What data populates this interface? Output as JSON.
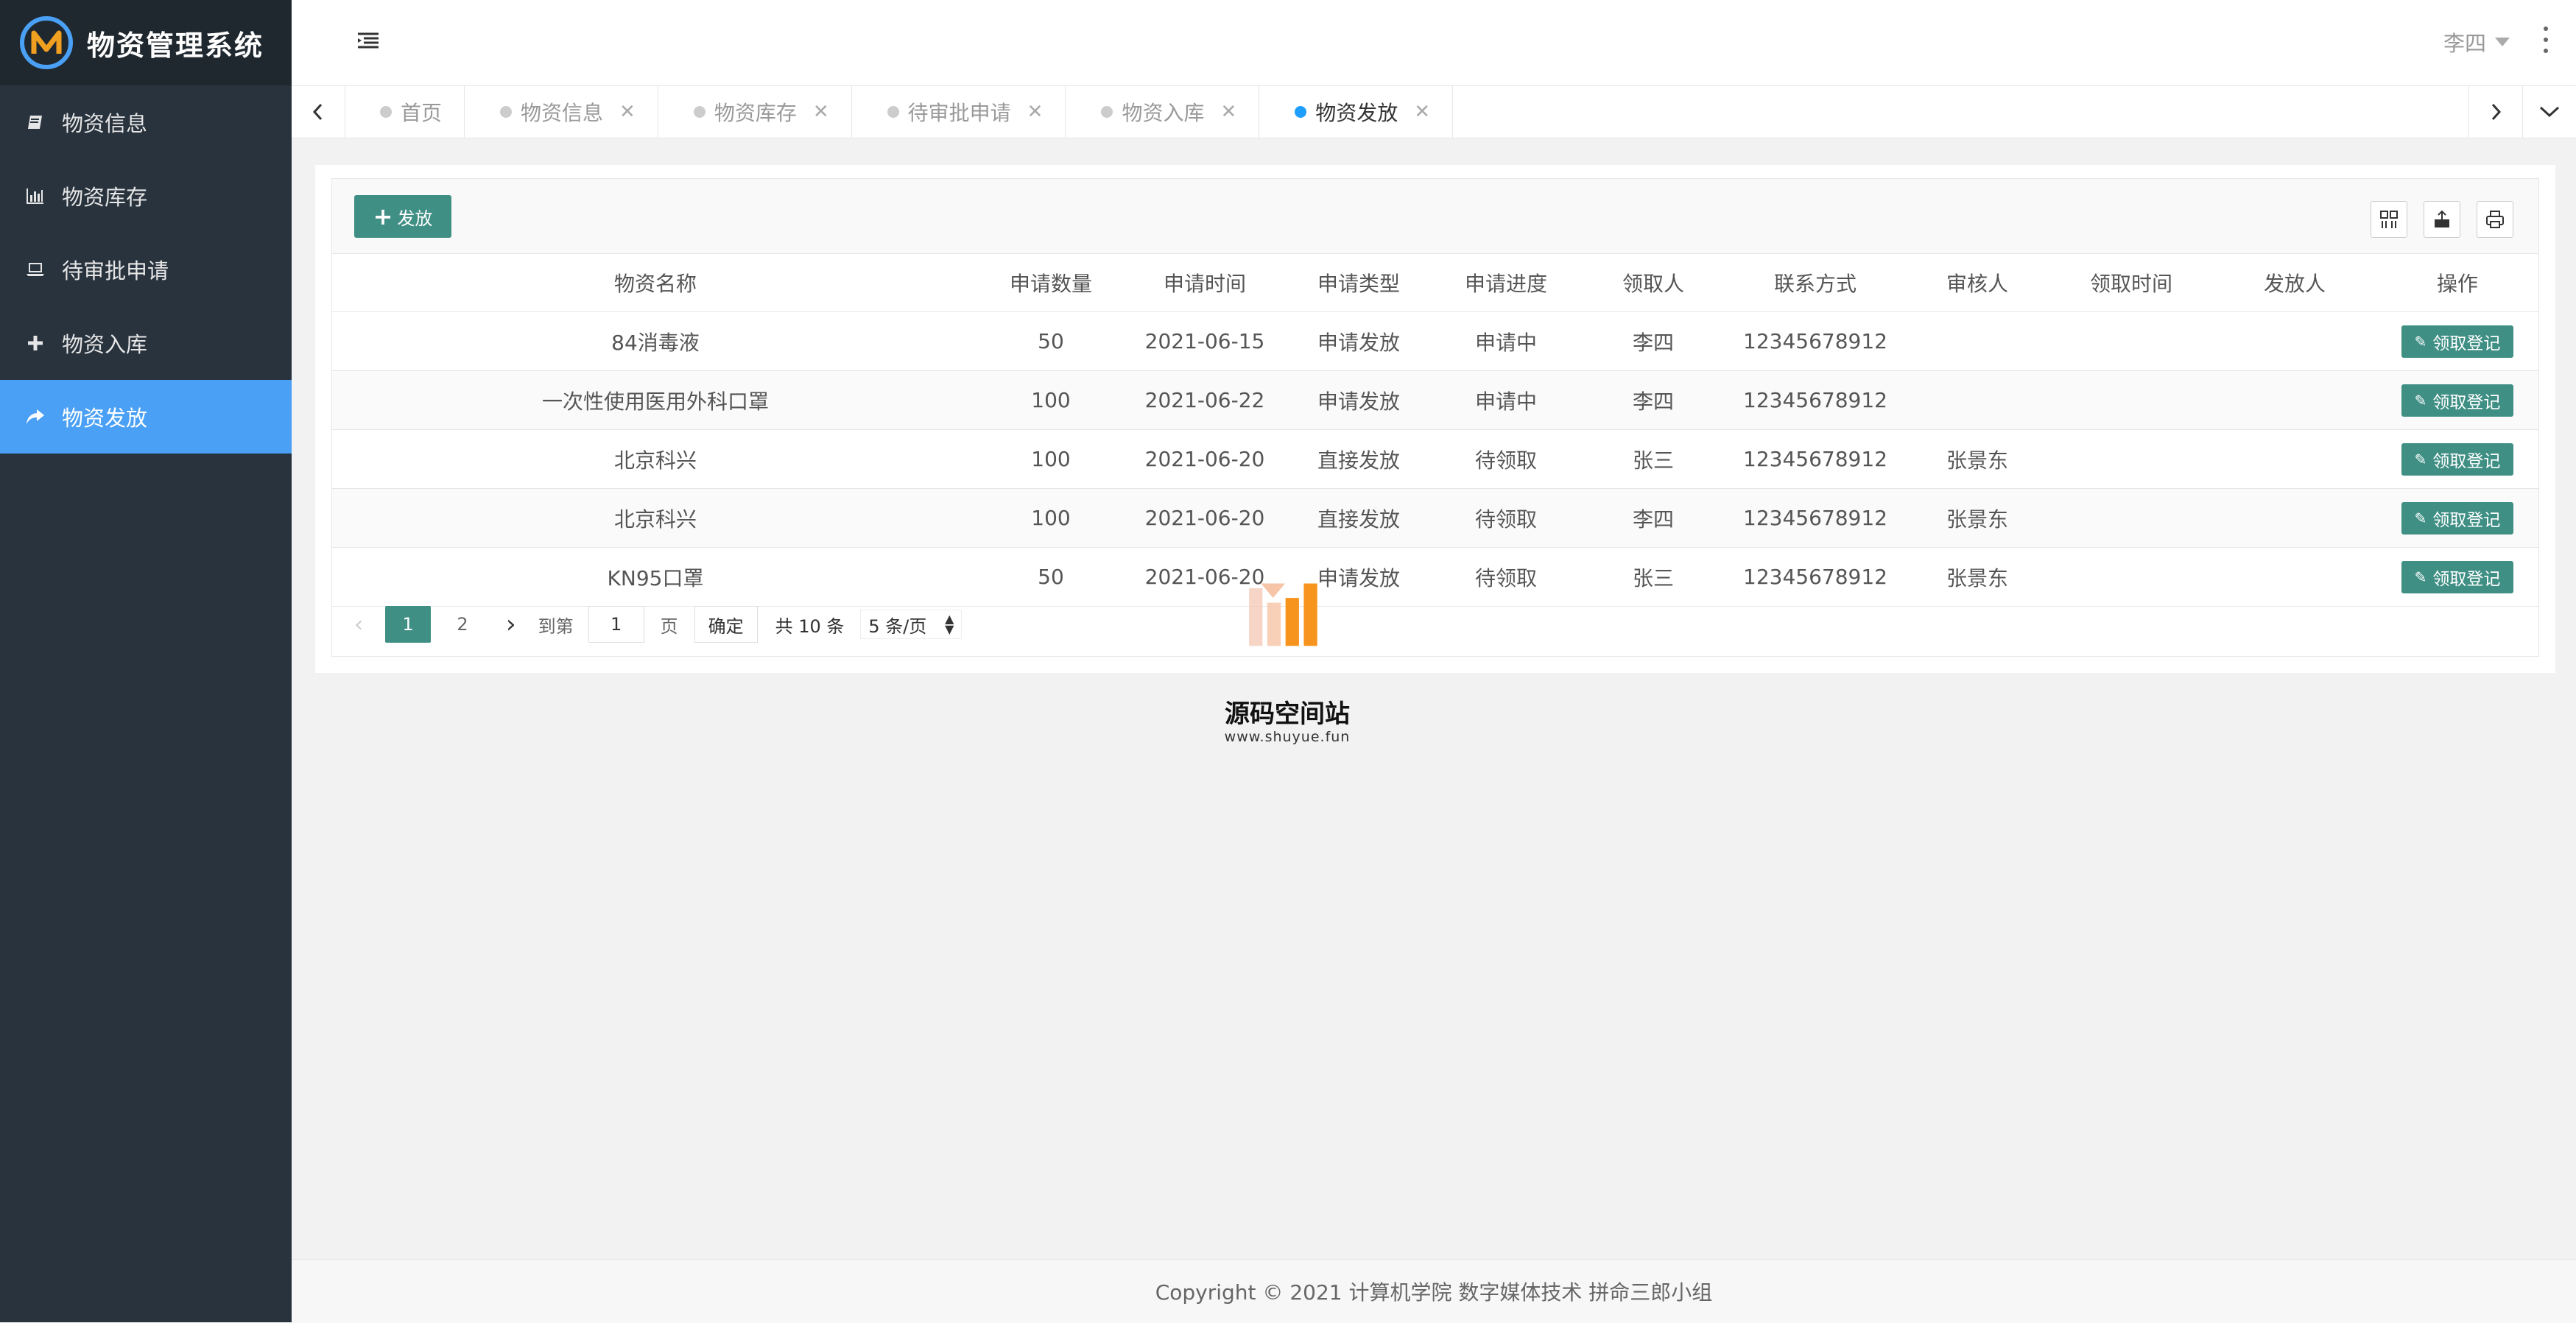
{
  "app": {
    "title": "物资管理系统"
  },
  "sidebar": {
    "items": [
      {
        "label": "物资信息",
        "icon": "book-icon",
        "active": false
      },
      {
        "label": "物资库存",
        "icon": "bar-chart-icon",
        "active": false
      },
      {
        "label": "待审批申请",
        "icon": "laptop-icon",
        "active": false
      },
      {
        "label": "物资入库",
        "icon": "plus-icon",
        "active": false
      },
      {
        "label": "物资发放",
        "icon": "share-icon",
        "active": true
      }
    ]
  },
  "header": {
    "user": "李四"
  },
  "tabs": [
    {
      "label": "首页",
      "closable": false,
      "active": false
    },
    {
      "label": "物资信息",
      "closable": true,
      "active": false
    },
    {
      "label": "物资库存",
      "closable": true,
      "active": false
    },
    {
      "label": "待审批申请",
      "closable": true,
      "active": false
    },
    {
      "label": "物资入库",
      "closable": true,
      "active": false
    },
    {
      "label": "物资发放",
      "closable": true,
      "active": true
    }
  ],
  "toolbar": {
    "add_label": "发放"
  },
  "table": {
    "columns": [
      "物资名称",
      "申请数量",
      "申请时间",
      "申请类型",
      "申请进度",
      "领取人",
      "联系方式",
      "审核人",
      "领取时间",
      "发放人",
      "操作"
    ],
    "rows": [
      [
        "84消毒液",
        "50",
        "2021-06-15",
        "申请发放",
        "申请中",
        "李四",
        "12345678912",
        "",
        "",
        ""
      ],
      [
        "一次性使用医用外科口罩",
        "100",
        "2021-06-22",
        "申请发放",
        "申请中",
        "李四",
        "12345678912",
        "",
        "",
        ""
      ],
      [
        "北京科兴",
        "100",
        "2021-06-20",
        "直接发放",
        "待领取",
        "张三",
        "12345678912",
        "张景东",
        "",
        ""
      ],
      [
        "北京科兴",
        "100",
        "2021-06-20",
        "直接发放",
        "待领取",
        "李四",
        "12345678912",
        "张景东",
        "",
        ""
      ],
      [
        "KN95口罩",
        "50",
        "2021-06-20",
        "申请发放",
        "待领取",
        "张三",
        "12345678912",
        "张景东",
        "",
        ""
      ]
    ],
    "action_label": "领取登记"
  },
  "pager": {
    "pages": [
      "1",
      "2"
    ],
    "current": "1",
    "goto_label": "到第",
    "goto_value": "1",
    "page_label": "页",
    "confirm_label": "确定",
    "total_label": "共 10 条",
    "size_label": "5 条/页"
  },
  "watermark": {
    "text": "源码空间站",
    "url": "www.shuyue.fun"
  },
  "footer": {
    "text": "Copyright © 2021 计算机学院 数字媒体技术 拼命三郎小组"
  },
  "colors": {
    "sidebar": "#28333e",
    "logo_bar": "#20282f",
    "active_menu": "#4aa0f5",
    "primary_button": "#3f8f84",
    "active_tab_dot": "#1e9fff"
  }
}
